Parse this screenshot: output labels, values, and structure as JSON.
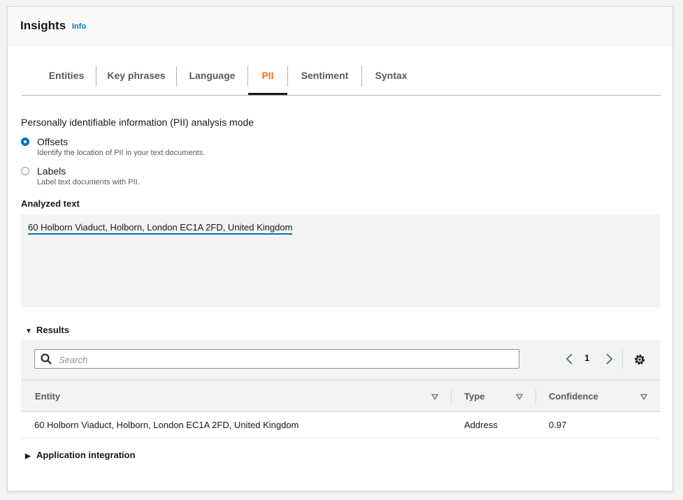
{
  "header": {
    "title": "Insights",
    "info_link": "Info"
  },
  "tabs": [
    {
      "label": "Entities",
      "active": false
    },
    {
      "label": "Key phrases",
      "active": false
    },
    {
      "label": "Language",
      "active": false
    },
    {
      "label": "PII",
      "active": true
    },
    {
      "label": "Sentiment",
      "active": false
    },
    {
      "label": "Syntax",
      "active": false
    }
  ],
  "pii_mode": {
    "label": "Personally identifiable information (PII) analysis mode",
    "selected": "offsets",
    "options": [
      {
        "label": "Offsets",
        "description": "Identify the location of PII in your text documents."
      },
      {
        "label": "Labels",
        "description": "Label text documents with PII."
      }
    ]
  },
  "analyzed": {
    "label": "Analyzed text",
    "text": "60 Holborn Viaduct, Holborn, London EC1A 2FD, United Kingdom"
  },
  "results": {
    "section_label": "Results",
    "expanded": true,
    "search_placeholder": "Search",
    "search_value": "",
    "page": "1",
    "columns": [
      "Entity",
      "Type",
      "Confidence"
    ],
    "rows": [
      {
        "entity": "60 Holborn Viaduct, Holborn, London EC1A 2FD, United Kingdom",
        "type": "Address",
        "confidence": "0.97"
      }
    ]
  },
  "app_integration": {
    "label": "Application integration",
    "expanded": false
  },
  "icons": {
    "search": "search-icon",
    "prev": "chevron-left-icon",
    "next": "chevron-right-icon",
    "settings": "gear-icon",
    "sort": "sort-down-icon",
    "expanded": "caret-down-icon",
    "collapsed": "caret-right-icon"
  },
  "colors": {
    "accent": "#ec7211",
    "link": "#0073bb",
    "highlight": "#0073bb"
  }
}
